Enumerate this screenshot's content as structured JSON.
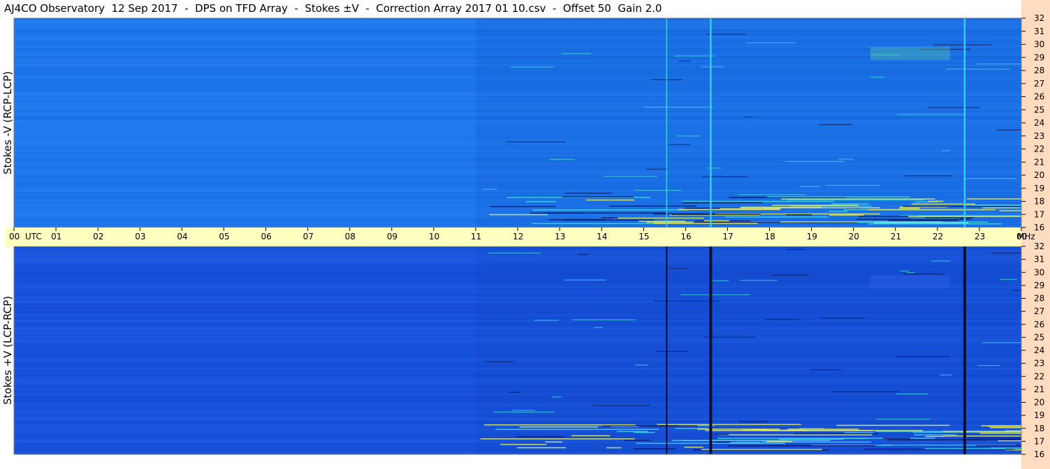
{
  "title": "AJ4CO Observatory  12 Sep 2017  -  DPS on TFD Array  -  Stokes ±V  -  Correction Array 2017 01 10.csv  -  Offset 50  Gain 2.0",
  "chart_data": [
    {
      "type": "heatmap",
      "ylabel": "Stokes -V (RCP-LCP)",
      "yunit": "MHz",
      "ylim": [
        16,
        32
      ],
      "yticks": [
        16,
        17,
        18,
        19,
        20,
        21,
        22,
        23,
        24,
        25,
        26,
        27,
        28,
        29,
        30,
        31,
        32
      ],
      "xlim": [
        0,
        24
      ],
      "background_color": "#1e78ee",
      "interference_lines_utc": [
        15.55,
        16.6,
        22.65
      ],
      "interference_color": "#35d4e6",
      "activity_start_utc": 11.0,
      "activity_band_mhz": [
        16.3,
        18.4
      ]
    },
    {
      "type": "heatmap",
      "ylabel": "Stokes +V (LCP-RCP)",
      "yunit": "MHz",
      "ylim": [
        16,
        32
      ],
      "yticks": [
        16,
        17,
        18,
        19,
        20,
        21,
        22,
        23,
        24,
        25,
        26,
        27,
        28,
        29,
        30,
        31,
        32
      ],
      "xlim": [
        0,
        24
      ],
      "background_color": "#1752dc",
      "interference_lines_utc": [
        15.55,
        16.6,
        22.65
      ],
      "interference_color": "#050a25",
      "activity_start_utc": 11.0,
      "activity_band_mhz": [
        16.3,
        18.4
      ]
    }
  ],
  "time_axis": {
    "labels": [
      "00",
      "01",
      "02",
      "03",
      "04",
      "05",
      "06",
      "07",
      "08",
      "09",
      "10",
      "11",
      "12",
      "13",
      "14",
      "15",
      "16",
      "17",
      "18",
      "19",
      "20",
      "21",
      "22",
      "23",
      "00"
    ],
    "unit_left": "UTC",
    "unit_right": "MHz",
    "background": "#ffffc0"
  },
  "colors": {
    "right_strip": "#ffdcc0",
    "highlight_yellow": "#e8f060",
    "highlight_cyan": "#40d8e0"
  }
}
